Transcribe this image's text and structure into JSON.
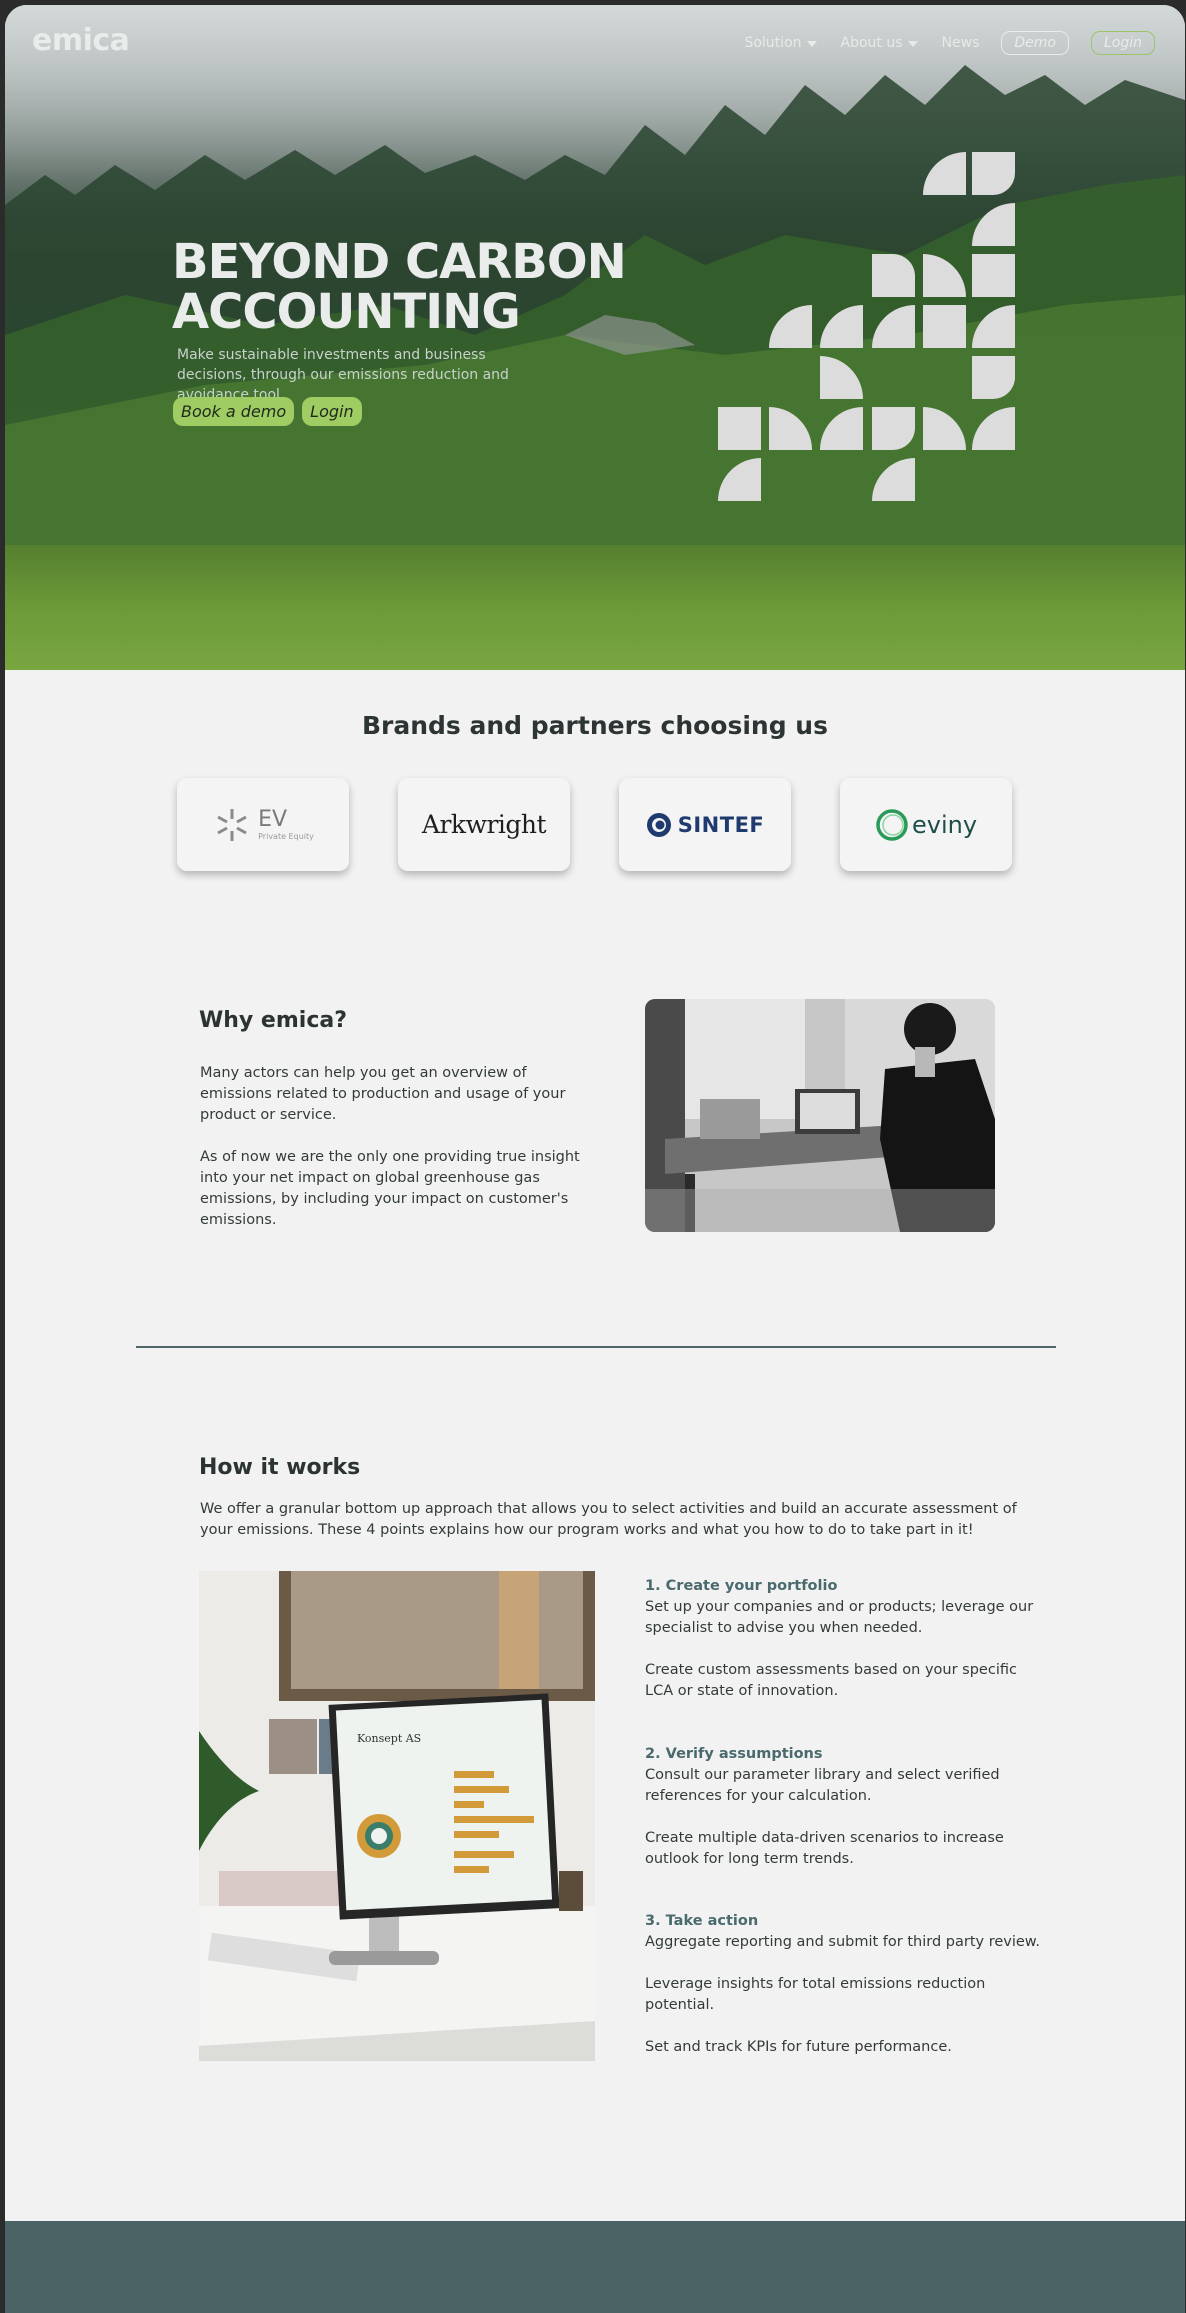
{
  "header": {
    "logo": "emica",
    "nav": [
      {
        "label": "Solution",
        "has_caret": true
      },
      {
        "label": "About us",
        "has_caret": true
      },
      {
        "label": "News",
        "has_caret": false
      }
    ],
    "demo_label": "Demo",
    "login_label": "Login"
  },
  "hero": {
    "title_line1": "BEYOND CARBON",
    "title_line2": "ACCOUNTING",
    "subtitle": "Make sustainable investments and business decisions, through our emissions reduction and avoidance tool.",
    "book_demo_label": "Book a demo",
    "login_label": "Login"
  },
  "brands": {
    "title": "Brands and partners choosing us",
    "items": [
      {
        "name": "EV",
        "sub": "Private Equity"
      },
      {
        "name": "Arkwright"
      },
      {
        "name": "SINTEF"
      },
      {
        "name": "eviny"
      }
    ]
  },
  "why": {
    "title": "Why emica?",
    "p1": "Many actors can help you get an overview of emissions related to production and usage of your product or service.",
    "p2": "As of now we are the only one providing true insight into your net impact on global greenhouse gas emissions, by including your impact on customer's emissions."
  },
  "how": {
    "title": "How it works",
    "intro": "We offer a granular bottom up approach that allows you to select activities and build an accurate assessment of your emissions. These 4 points explains how our program works and what you how to do to take part in it!",
    "screen_company": "Konsept AS",
    "steps": [
      {
        "title": "1. Create your portfolio",
        "p1": "Set up your companies and or products; leverage our specialist to advise you when needed.",
        "p2": "Create custom assessments based on your specific LCA or state of innovation."
      },
      {
        "title": "2. Verify assumptions",
        "p1": "Consult our parameter library and select verified references for your calculation.",
        "p2": "Create multiple data-driven scenarios to increase outlook for long term trends."
      },
      {
        "title": "3. Take action",
        "p1": "Aggregate reporting and submit for third party review.",
        "p2": "Leverage insights for total emissions reduction potential.",
        "p3": "Set and track KPIs for future performance."
      }
    ]
  },
  "colors": {
    "accent_green": "#9fcc63",
    "teal": "#4a6466",
    "background": "#f2f2f2"
  }
}
